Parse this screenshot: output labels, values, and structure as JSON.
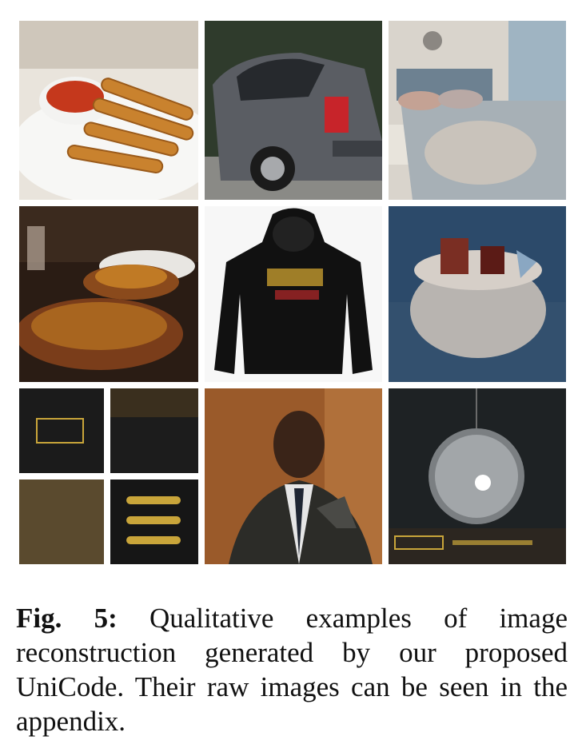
{
  "figure": {
    "label": "Fig. 5:",
    "caption": " Qualitative examples of image reconstruction generated by our proposed UniCode. Their raw images can be seen in the appendix.",
    "panels": [
      {
        "id": "fries",
        "icon": "food-image"
      },
      {
        "id": "car",
        "icon": "car-image"
      },
      {
        "id": "bedroom",
        "icon": "bedroom-image"
      },
      {
        "id": "food-platter",
        "icon": "food-platter-image"
      },
      {
        "id": "hoodie",
        "icon": "hoodie-image"
      },
      {
        "id": "basket",
        "icon": "gift-basket-image"
      },
      {
        "id": "signage",
        "icon": "sale-sign-collage-image"
      },
      {
        "id": "speaker",
        "icon": "person-at-podium-image"
      },
      {
        "id": "glass-orb",
        "icon": "glass-orb-image"
      }
    ]
  }
}
